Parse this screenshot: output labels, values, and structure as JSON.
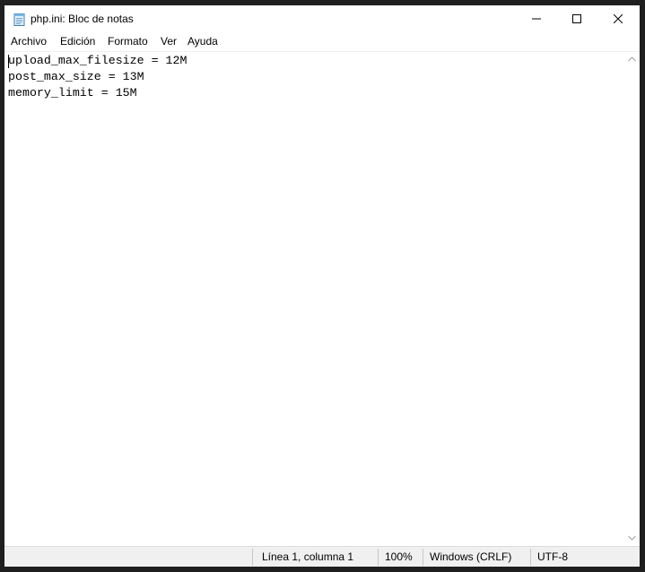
{
  "window": {
    "title": "php.ini: Bloc de notas",
    "icons": {
      "app": "notepad-icon",
      "minimize": "minimize-icon",
      "maximize": "maximize-icon",
      "close": "close-icon"
    }
  },
  "menu": {
    "items": [
      {
        "label": "Archivo"
      },
      {
        "label": "Edición"
      },
      {
        "label": "Formato"
      },
      {
        "label": "Ver"
      },
      {
        "label": "Ayuda"
      }
    ]
  },
  "editor": {
    "lines": [
      "upload_max_filesize = 12M",
      "post_max_size = 13M",
      "memory_limit = 15M"
    ]
  },
  "status": {
    "position": "Línea 1, columna 1",
    "zoom": "100%",
    "line_ending": "Windows (CRLF)",
    "encoding": "UTF-8"
  },
  "colors": {
    "background": "#ffffff",
    "statusbar": "#f0f0f0",
    "outer_frame": "#1f1f1f"
  }
}
